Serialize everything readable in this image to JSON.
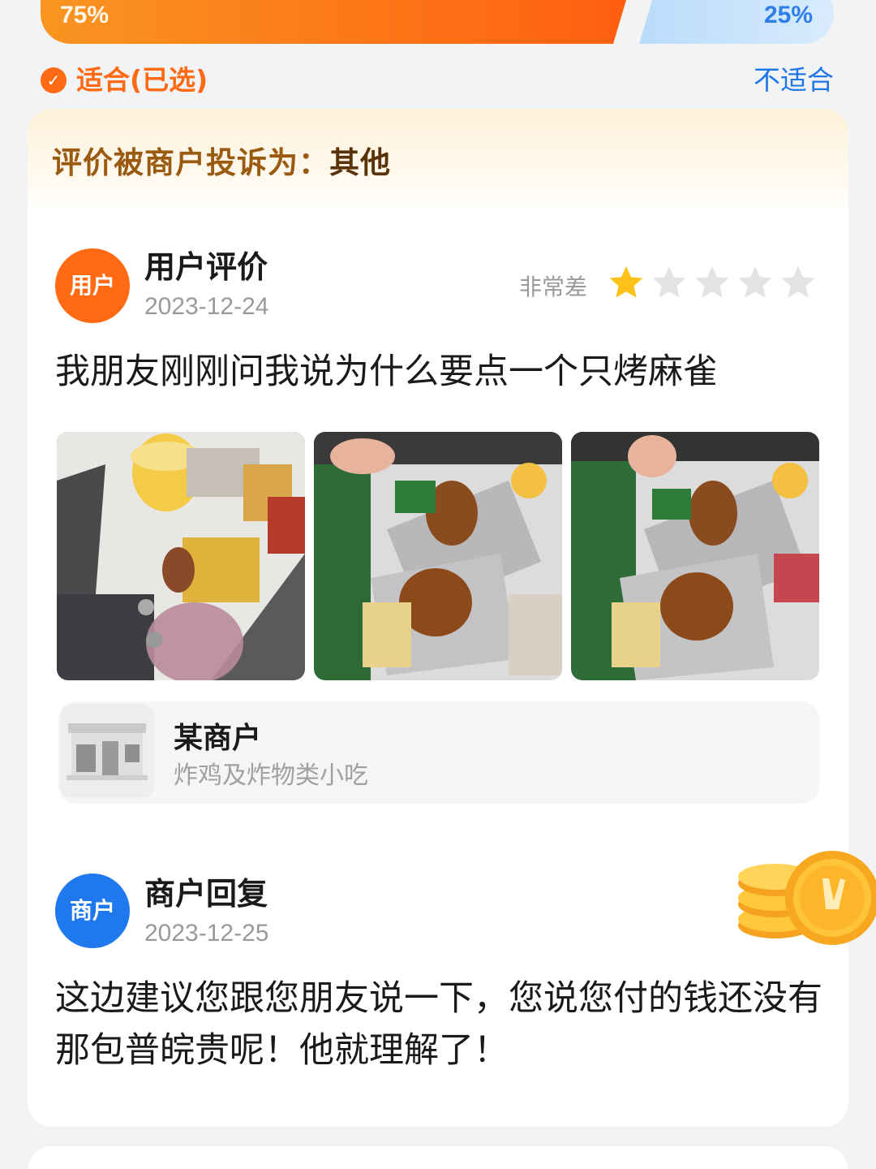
{
  "vote": {
    "agree_percent": "75%",
    "disagree_percent": "25%",
    "agree_fraction": 0.75,
    "agree_label": "适合(已选)",
    "disagree_label": "不适合"
  },
  "complaint": {
    "label": "评价被商户投诉为：",
    "value": "其他"
  },
  "review": {
    "avatar_text": "用户",
    "title": "用户评价",
    "date": "2023-12-24",
    "rating_text": "非常差",
    "rating": 1,
    "rating_max": 5,
    "text": "我朋友刚刚问我说为什么要点一个只烤麻雀"
  },
  "merchant": {
    "name": "某商户",
    "category": "炸鸡及炸物类小吃"
  },
  "reply": {
    "avatar_text": "商户",
    "title": "商户回复",
    "date": "2023-12-25",
    "text": "这边建议您跟您朋友说一下，您说您付的钱还没有那包普皖贵呢！他就理解了！"
  },
  "colors": {
    "accent_orange": "#ff6a12",
    "accent_blue": "#1f78ee",
    "star_active": "#ffc21a",
    "star_inactive": "#e3e3e3"
  }
}
